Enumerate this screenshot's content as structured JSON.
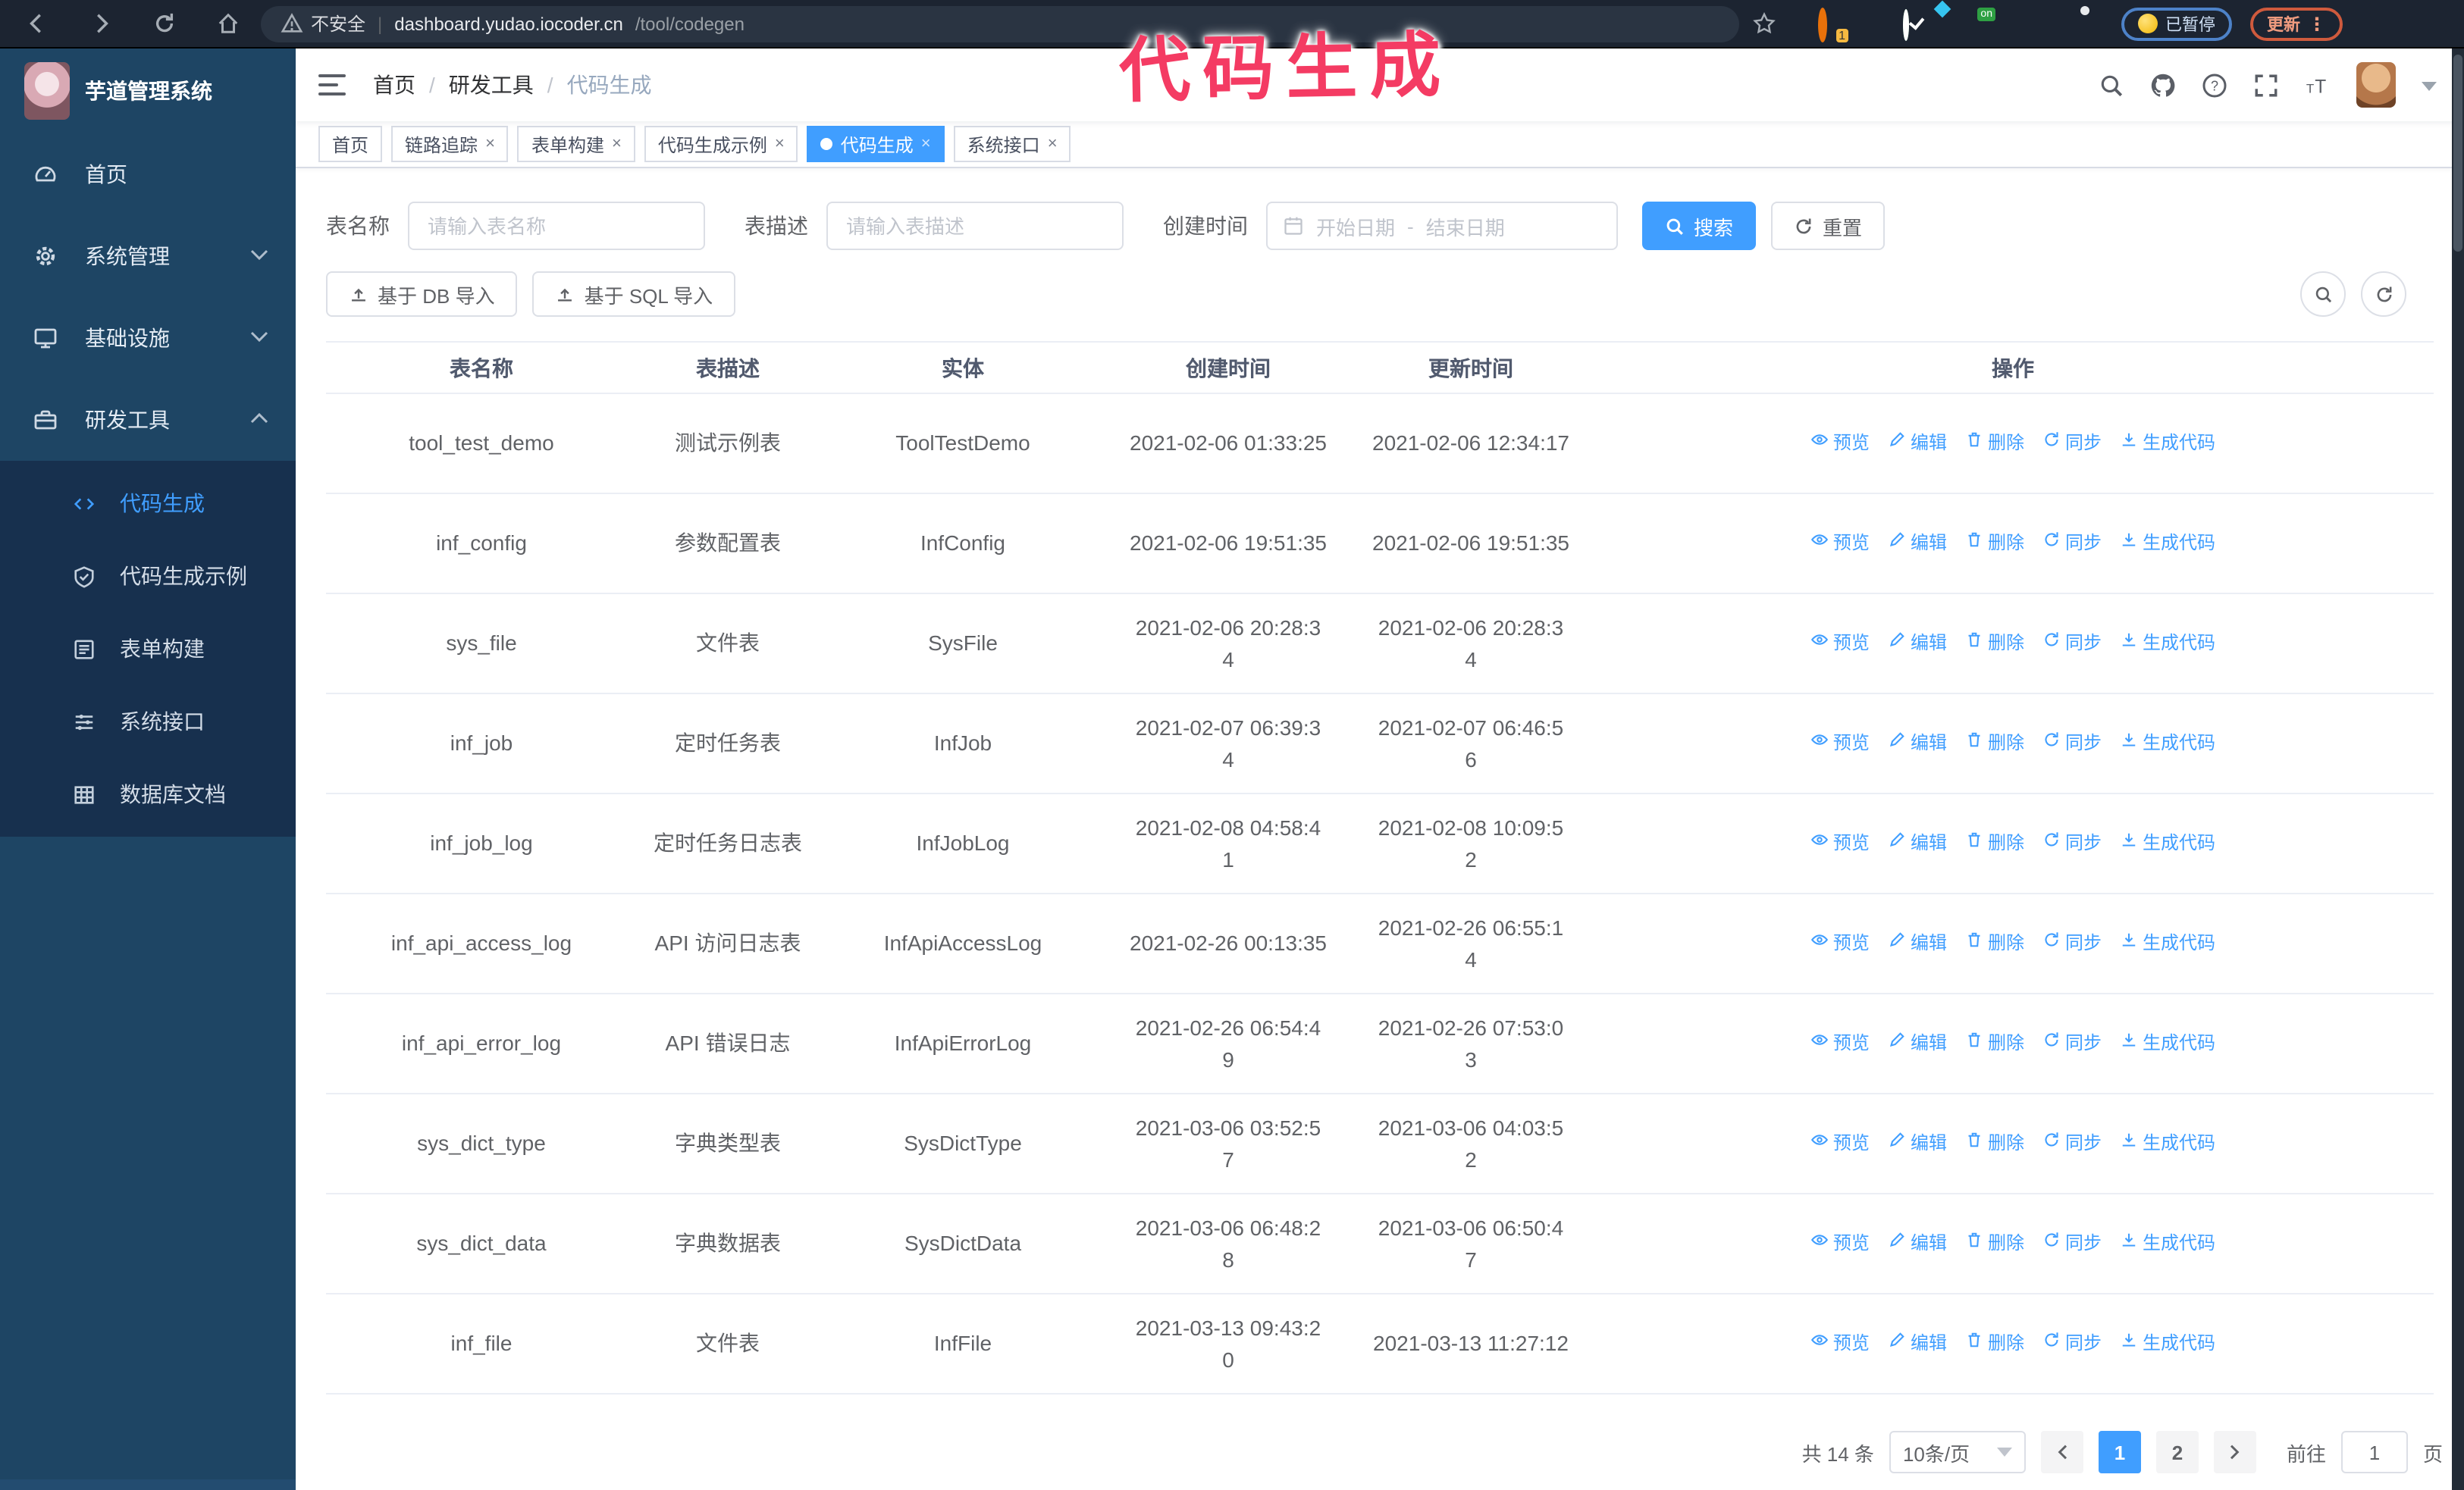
{
  "colors": {
    "accent": "#409eff",
    "annotation": "#f43b63",
    "sidebar-bg": "#1e4564",
    "submenu-bg": "#17304e",
    "paused-accent": "#4d82c8",
    "update-accent": "#cf5a3d"
  },
  "annotation": {
    "text": "代码生成"
  },
  "browser": {
    "security_label": "不安全",
    "url_host": "dashboard.yudao.iocoder.cn",
    "url_path": "/tool/codegen",
    "paused_badge": "已暂停",
    "update_button": "更新",
    "menu_dots": "⋮"
  },
  "sidebar": {
    "app_title": "芋道管理系统",
    "items": [
      {
        "label": "首页",
        "icon": "dashboard-icon",
        "chevron": ""
      },
      {
        "label": "系统管理",
        "icon": "gear-icon",
        "chevron": "down"
      },
      {
        "label": "基础设施",
        "icon": "monitor-icon",
        "chevron": "down"
      },
      {
        "label": "研发工具",
        "icon": "toolbox-icon",
        "chevron": "up"
      }
    ],
    "sub_items": [
      {
        "label": "代码生成",
        "icon": "code-icon",
        "active": true
      },
      {
        "label": "代码生成示例",
        "icon": "example-icon",
        "active": false
      },
      {
        "label": "表单构建",
        "icon": "form-icon",
        "active": false
      },
      {
        "label": "系统接口",
        "icon": "api-icon",
        "active": false
      },
      {
        "label": "数据库文档",
        "icon": "database-icon",
        "active": false
      }
    ]
  },
  "navbar": {
    "breadcrumb": [
      "首页",
      "研发工具",
      "代码生成"
    ],
    "separator": "/"
  },
  "tabs": [
    {
      "label": "首页",
      "closable": false,
      "active": false
    },
    {
      "label": "链路追踪",
      "closable": true,
      "active": false
    },
    {
      "label": "表单构建",
      "closable": true,
      "active": false
    },
    {
      "label": "代码生成示例",
      "closable": true,
      "active": false
    },
    {
      "label": "代码生成",
      "closable": true,
      "active": true
    },
    {
      "label": "系统接口",
      "closable": true,
      "active": false
    }
  ],
  "ui": {
    "close_glyph": "×"
  },
  "filters": {
    "table_name_label": "表名称",
    "table_name_placeholder": "请输入表名称",
    "table_desc_label": "表描述",
    "table_desc_placeholder": "请输入表描述",
    "create_time_label": "创建时间",
    "date_start_placeholder": "开始日期",
    "date_separator": "-",
    "date_end_placeholder": "结束日期",
    "search_label": "搜索",
    "reset_label": "重置"
  },
  "toolbar": {
    "import_db_label": "基于 DB 导入",
    "import_sql_label": "基于 SQL 导入"
  },
  "table": {
    "columns": [
      "表名称",
      "表描述",
      "实体",
      "创建时间",
      "更新时间",
      "操作"
    ],
    "row_actions": [
      "预览",
      "编辑",
      "删除",
      "同步",
      "生成代码"
    ],
    "rows": [
      {
        "name": "tool_test_demo",
        "desc": "测试示例表",
        "entity": "ToolTestDemo",
        "created": "2021-02-06 01:33:25",
        "updated": "2021-02-06 12:34:17"
      },
      {
        "name": "inf_config",
        "desc": "参数配置表",
        "entity": "InfConfig",
        "created": "2021-02-06 19:51:35",
        "updated": "2021-02-06 19:51:35"
      },
      {
        "name": "sys_file",
        "desc": "文件表",
        "entity": "SysFile",
        "created": "2021-02-06 20:28:3\n4",
        "updated": "2021-02-06 20:28:3\n4"
      },
      {
        "name": "inf_job",
        "desc": "定时任务表",
        "entity": "InfJob",
        "created": "2021-02-07 06:39:3\n4",
        "updated": "2021-02-07 06:46:5\n6"
      },
      {
        "name": "inf_job_log",
        "desc": "定时任务日志表",
        "entity": "InfJobLog",
        "created": "2021-02-08 04:58:4\n1",
        "updated": "2021-02-08 10:09:5\n2"
      },
      {
        "name": "inf_api_access_log",
        "desc": "API 访问日志表",
        "entity": "InfApiAccessLog",
        "created": "2021-02-26 00:13:35",
        "updated": "2021-02-26 06:55:1\n4"
      },
      {
        "name": "inf_api_error_log",
        "desc": "API 错误日志",
        "entity": "InfApiErrorLog",
        "created": "2021-02-26 06:54:4\n9",
        "updated": "2021-02-26 07:53:0\n3"
      },
      {
        "name": "sys_dict_type",
        "desc": "字典类型表",
        "entity": "SysDictType",
        "created": "2021-03-06 03:52:5\n7",
        "updated": "2021-03-06 04:03:5\n2"
      },
      {
        "name": "sys_dict_data",
        "desc": "字典数据表",
        "entity": "SysDictData",
        "created": "2021-03-06 06:48:2\n8",
        "updated": "2021-03-06 06:50:4\n7"
      },
      {
        "name": "inf_file",
        "desc": "文件表",
        "entity": "InfFile",
        "created": "2021-03-13 09:43:2\n0",
        "updated": "2021-03-13 11:27:12"
      }
    ]
  },
  "pagination": {
    "total_label": "共 14 条",
    "page_size": "10条/页",
    "pages": [
      "1",
      "2"
    ],
    "active_page": "1",
    "goto_label": "前往",
    "goto_value": "1",
    "page_label": "页"
  }
}
